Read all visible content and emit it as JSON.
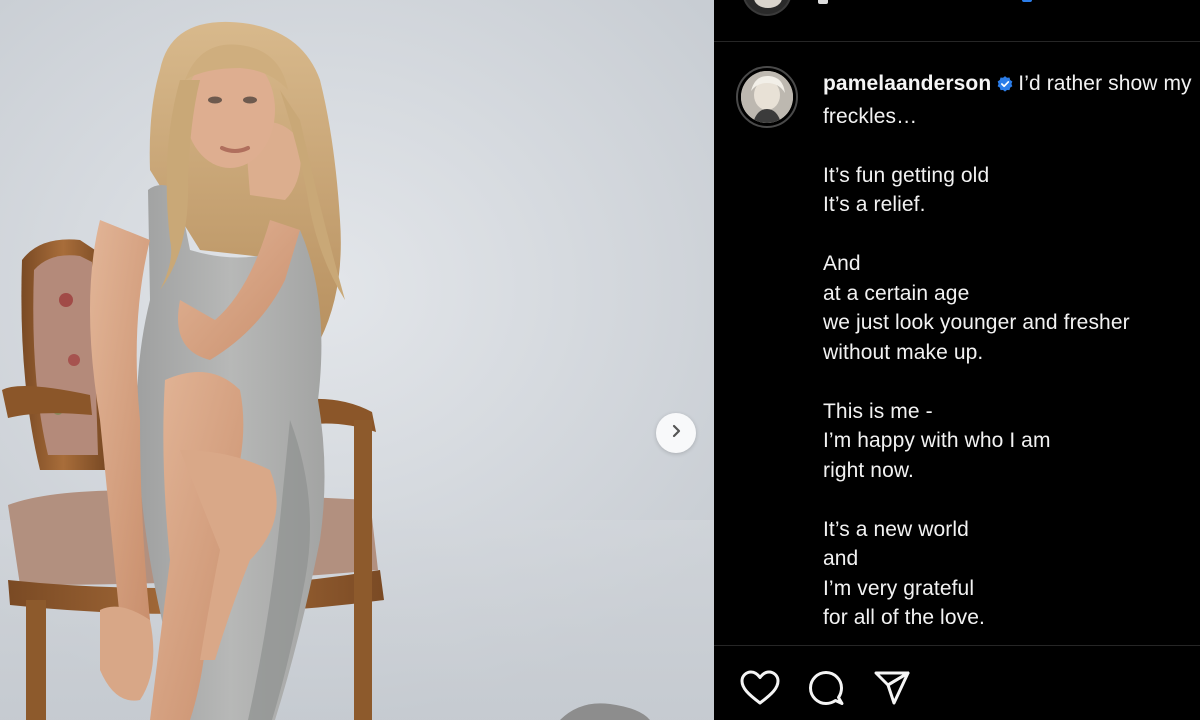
{
  "post": {
    "username": "pamelaanderson",
    "verified": true,
    "caption_first": "I’d rather show my freckles…",
    "caption_lines": [
      "",
      "It’s fun getting old",
      "It’s a relief.",
      "",
      "And",
      "at a certain age",
      "we just look younger and fresher",
      "without make up.",
      "",
      "This is me -",
      "I’m happy with who I am",
      "right now.",
      "",
      "It’s a new world",
      "and",
      "I’m very grateful",
      "for all of the love."
    ]
  },
  "icons": {
    "verified": "verified-badge-icon",
    "next": "chevron-right-icon",
    "like": "heart-icon",
    "comment": "comment-icon",
    "share": "paper-plane-icon"
  },
  "colors": {
    "background": "#000000",
    "text": "#f5f5f5",
    "verified_blue": "#2b7de9",
    "photo_backdrop": "#d7dbe0"
  }
}
